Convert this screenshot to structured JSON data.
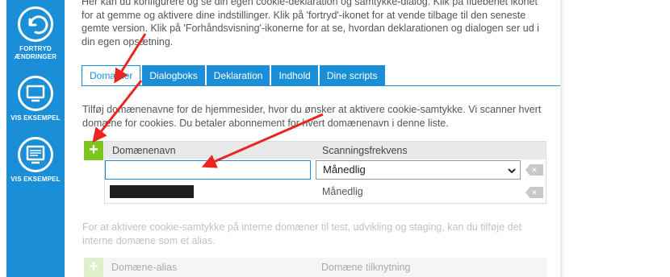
{
  "toolbar": {
    "undo_label_1": "FORTRYD",
    "undo_label_2": "ÆNDRINGER",
    "preview1_label": "VIS EKSEMPEL",
    "preview2_label": "VIS EKSEMPEL"
  },
  "intro_text": "Her kan du konfigurere og se din egen cookie-deklaration og samtykke-dialog. Klik på fluebenet ikonet for at gemme og aktivere dine indstillinger. Klik på 'fortryd'-ikonet for at vende tilbage til den seneste gemte version. Klik på 'Forhåndsvisning'-ikonerne for at se, hvordan deklarationen og dialogen ser ud i din egen opsætning.",
  "tabs": [
    {
      "label": "Domæner",
      "active": true
    },
    {
      "label": "Dialogboks",
      "active": false
    },
    {
      "label": "Deklaration",
      "active": false
    },
    {
      "label": "Indhold",
      "active": false
    },
    {
      "label": "Dine scripts",
      "active": false
    }
  ],
  "domains": {
    "description": "Tilføj domænenavne for de hjemmesider, hvor du ønsker at aktivere cookie-samtykke. Vi scanner hvert domæne for cookies. Du betaler abonnement for hvert domænenavn i denne liste.",
    "add_symbol": "+",
    "col_domain": "Domænenavn",
    "col_frequency": "Scanningsfrekvens",
    "new_row": {
      "domain_value": "",
      "frequency": "Månedlig"
    },
    "rows": [
      {
        "domain": "[redacted]",
        "frequency": "Månedlig"
      }
    ],
    "delete_symbol": "✕"
  },
  "aliases": {
    "description": "For at aktivere cookie-samtykke på interne domæner til test, udvikling og staging, kan du tilføje det interne domæne som et alias.",
    "add_symbol": "+",
    "col_alias": "Domæne-alias",
    "col_link": "Domæne tilknytning"
  },
  "colors": {
    "accent": "#1a8fd8",
    "add_green": "#7cc520",
    "annotation_red": "#e8261f"
  }
}
